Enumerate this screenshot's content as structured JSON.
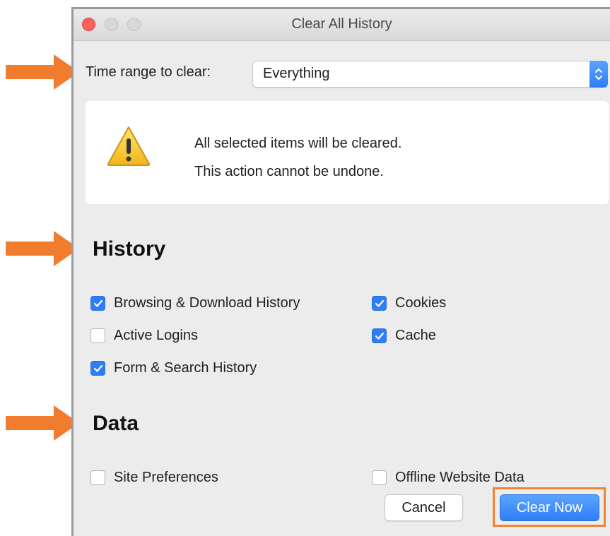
{
  "window": {
    "title": "Clear All History"
  },
  "time_range": {
    "label": "Time range to clear:",
    "selected": "Everything"
  },
  "warning": {
    "line1": "All selected items will be cleared.",
    "line2": "This action cannot be undone.",
    "icon": "warning-icon"
  },
  "history": {
    "heading": "History",
    "items": [
      {
        "label": "Browsing & Download History",
        "checked": true
      },
      {
        "label": "Cookies",
        "checked": true
      },
      {
        "label": "Active Logins",
        "checked": false
      },
      {
        "label": "Cache",
        "checked": true
      },
      {
        "label": "Form & Search History",
        "checked": true
      }
    ]
  },
  "data_section": {
    "heading": "Data",
    "items": [
      {
        "label": "Site Preferences",
        "checked": false
      },
      {
        "label": "Offline Website Data",
        "checked": false
      }
    ]
  },
  "buttons": {
    "cancel": "Cancel",
    "clear_now": "Clear Now"
  },
  "colors": {
    "accent": "#2e7cf6",
    "annotation": "#f07d2e",
    "close_button": "#fc605c"
  }
}
